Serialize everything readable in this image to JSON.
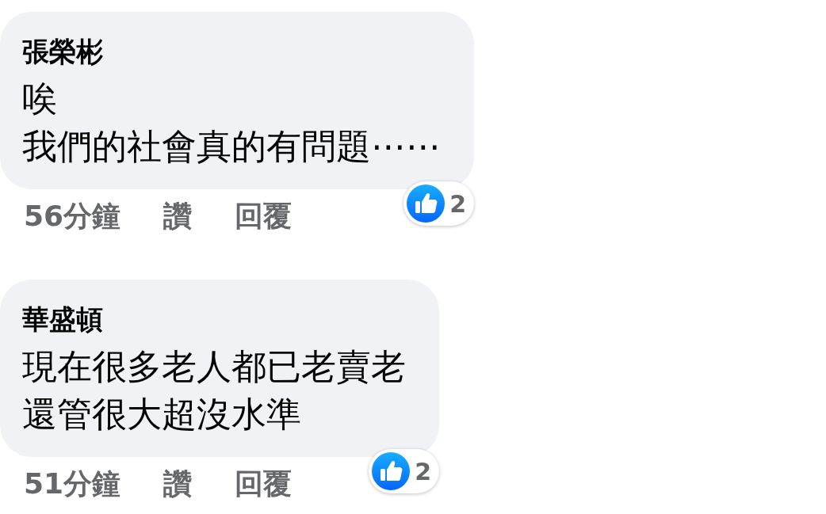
{
  "comments": [
    {
      "author": "張榮彬",
      "body_lines": [
        "唉",
        "我們的社會真的有問題⋯⋯"
      ],
      "time": "56分鐘",
      "actions": [
        "讚",
        "回覆"
      ],
      "reaction_count": "2"
    },
    {
      "author": "華盛頓",
      "body_lines": [
        "現在很多老人都已老賣老",
        "還管很大超沒水準"
      ],
      "time": "51分鐘",
      "actions": [
        "讚",
        "回覆"
      ],
      "reaction_count": "2"
    }
  ]
}
